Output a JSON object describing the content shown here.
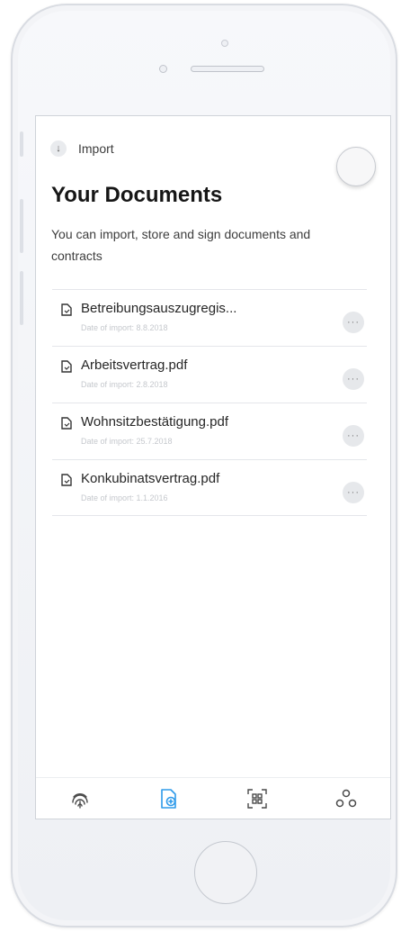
{
  "header": {
    "import_label": "Import",
    "title": "Your Documents",
    "subtitle": "You can import, store and sign documents and contracts"
  },
  "documents": [
    {
      "name": "Betreibungsauszugregis...",
      "date": "Date of import: 8.8.2018"
    },
    {
      "name": "Arbeitsvertrag.pdf",
      "date": "Date of import: 2.8.2018"
    },
    {
      "name": "Wohnsitzbestätigung.pdf",
      "date": "Date of import: 25.7.2018"
    },
    {
      "name": "Konkubinatsvertrag.pdf",
      "date": "Date of import: 1.1.2016"
    }
  ],
  "more_label": "···",
  "nav": {
    "items": [
      {
        "icon": "fingerprint-icon",
        "active": false
      },
      {
        "icon": "document-add-icon",
        "active": true
      },
      {
        "icon": "qr-scan-icon",
        "active": false
      },
      {
        "icon": "network-icon",
        "active": false
      }
    ],
    "active_color": "#2f9bea",
    "inactive_color": "#4a4a4a"
  }
}
